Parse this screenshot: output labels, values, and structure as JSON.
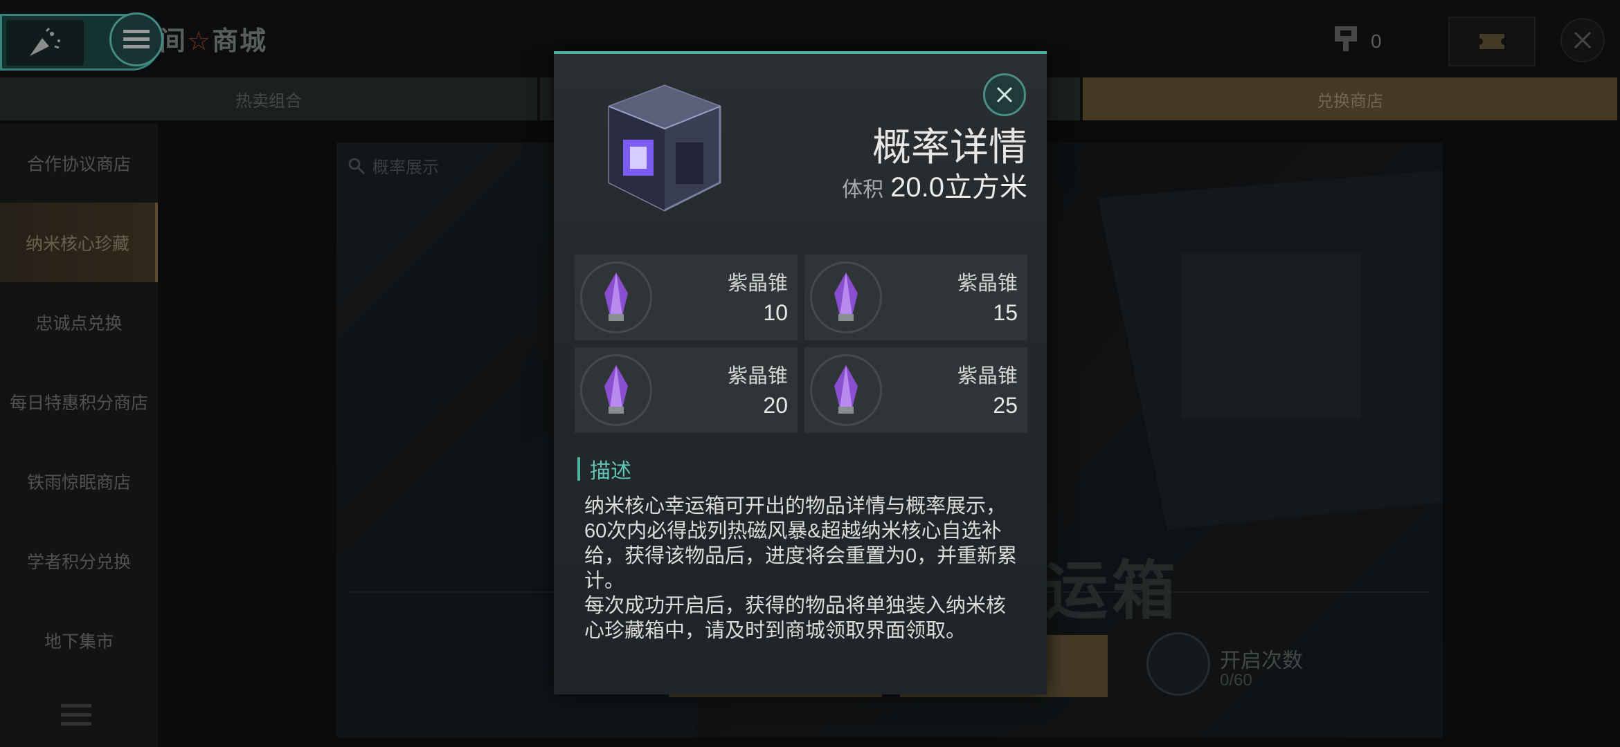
{
  "header": {
    "title": "商城",
    "title_prefix": "间",
    "key_count": "0"
  },
  "tabs": [
    {
      "label": "热卖组合",
      "active": false
    },
    {
      "label": "",
      "active": false
    },
    {
      "label": "",
      "active": false
    },
    {
      "label": "兑换商店",
      "active": true
    }
  ],
  "sidebar": {
    "items": [
      {
        "label": "合作协议商店",
        "active": false
      },
      {
        "label": "纳米核心珍藏",
        "active": true
      },
      {
        "label": "忠诚点兑换",
        "active": false
      },
      {
        "label": "每日特惠积分商店",
        "active": false
      },
      {
        "label": "铁雨惊眠商店",
        "active": false
      },
      {
        "label": "学者积分兑换",
        "active": false
      },
      {
        "label": "地下集市",
        "active": false
      }
    ]
  },
  "content": {
    "probability_label": "概率展示",
    "big_title": "运箱",
    "open_count_label": "开启次数",
    "open_count_value": "0/60"
  },
  "modal": {
    "title": "概率详情",
    "volume_label": "体积",
    "volume_value": "20.0立方米",
    "items": [
      {
        "name": "紫晶锥",
        "qty": "10"
      },
      {
        "name": "紫晶锥",
        "qty": "15"
      },
      {
        "name": "紫晶锥",
        "qty": "20"
      },
      {
        "name": "紫晶锥",
        "qty": "25"
      }
    ],
    "desc_heading": "描述",
    "desc_para1": "纳米核心幸运箱可开出的物品详情与概率展示，60次内必得战列热磁风暴&超越纳米核心自选补给，获得该物品后，进度将会重置为0，并重新累计。",
    "desc_para2": "每次成功开启后，获得的物品将单独装入纳米核心珍藏箱中，请及时到商城领取界面领取。"
  },
  "colors": {
    "accent": "#4fb0a6",
    "gold": "#6e5a36",
    "crystal": "#8a4fd0"
  }
}
